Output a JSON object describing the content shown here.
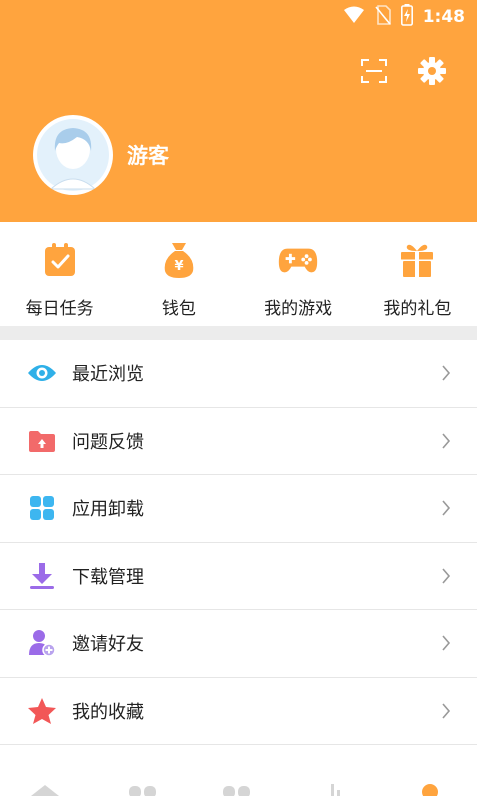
{
  "status_bar": {
    "time": "1:48",
    "icons": [
      "wifi-icon",
      "no-sim-icon",
      "battery-charging-icon"
    ]
  },
  "header": {
    "background": "#FFA43E",
    "actions": [
      {
        "icon": "scan-icon"
      },
      {
        "icon": "gear-icon"
      }
    ],
    "profile": {
      "avatar_icon": "avatar-icon",
      "name": "游客"
    }
  },
  "quick_actions": [
    {
      "label": "每日任务",
      "icon": "daily-task-icon"
    },
    {
      "label": "钱包",
      "icon": "wallet-icon"
    },
    {
      "label": "我的游戏",
      "icon": "gamepad-icon"
    },
    {
      "label": "我的礼包",
      "icon": "gift-icon"
    }
  ],
  "menu": [
    {
      "label": "最近浏览",
      "icon": "eye-icon"
    },
    {
      "label": "问题反馈",
      "icon": "feedback-folder-icon"
    },
    {
      "label": "应用卸载",
      "icon": "apps-grid-icon"
    },
    {
      "label": "下载管理",
      "icon": "download-icon"
    },
    {
      "label": "邀请好友",
      "icon": "invite-friend-icon"
    },
    {
      "label": "我的收藏",
      "icon": "star-icon"
    }
  ],
  "colors": {
    "accent": "#FFA43E",
    "eye": "#2FB0E8",
    "feedback": "#F26A6A",
    "apps": "#3DB6F0",
    "download": "#9B6BE8",
    "invite": "#9B6BE8",
    "star": "#F25757"
  }
}
